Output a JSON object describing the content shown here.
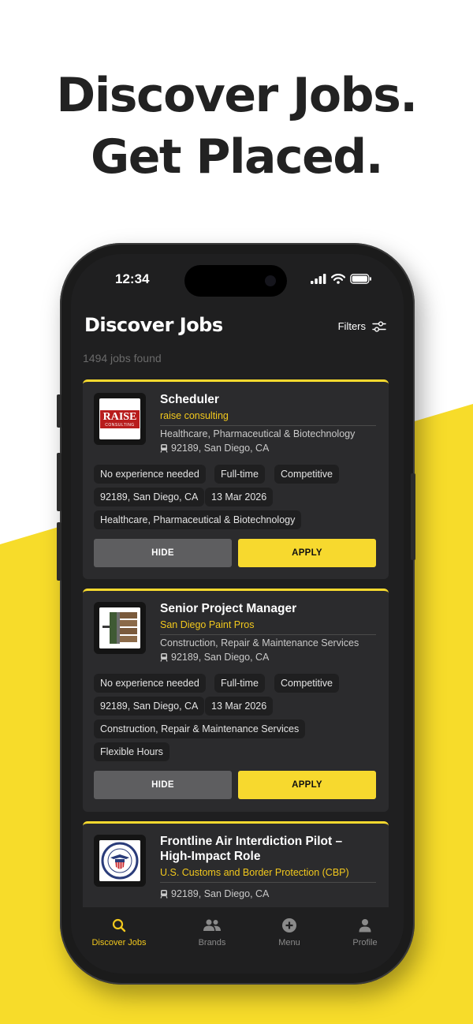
{
  "headline": {
    "line1": "Discover Jobs.",
    "line2": "Get Placed."
  },
  "colors": {
    "accent": "#f7d92e",
    "background_yellow": "#f7dc2a",
    "dark": "#1f1f20",
    "card": "#2b2b2d"
  },
  "status_bar": {
    "time": "12:34"
  },
  "header": {
    "title": "Discover Jobs",
    "filters_label": "Filters",
    "jobs_found": "1494 jobs found"
  },
  "jobs": [
    {
      "title": "Scheduler",
      "company": "raise consulting",
      "industry": "Healthcare, Pharmaceutical & Biotechnology",
      "location": "92189, San Diego, CA",
      "logo_text": "RAISE",
      "logo_subtext": "CONSULTING",
      "tags": [
        "No experience needed",
        "Full-time",
        "Competitive",
        "92189, San Diego, CA",
        "13 Mar 2026",
        "Healthcare, Pharmaceutical & Biotechnology"
      ],
      "hide_label": "HIDE",
      "apply_label": "APPLY"
    },
    {
      "title": "Senior Project Manager",
      "company": "San Diego Paint Pros",
      "industry": "Construction, Repair & Maintenance Services",
      "location": "92189, San Diego, CA",
      "tags": [
        "No experience needed",
        "Full-time",
        "Competitive",
        "92189, San Diego, CA",
        "13 Mar 2026",
        "Construction, Repair & Maintenance Services",
        "Flexible Hours"
      ],
      "hide_label": "HIDE",
      "apply_label": "APPLY"
    },
    {
      "title": "Frontline Air Interdiction Pilot – High-Impact Role",
      "company": "U.S. Customs and Border Protection (CBP)",
      "location": "92189, San Diego, CA"
    }
  ],
  "tabbar": {
    "items": [
      {
        "label": "Discover Jobs",
        "icon": "search-icon",
        "active": true
      },
      {
        "label": "Brands",
        "icon": "people-icon",
        "active": false
      },
      {
        "label": "Menu",
        "icon": "plus-circle-icon",
        "active": false
      },
      {
        "label": "Profile",
        "icon": "person-icon",
        "active": false
      }
    ]
  }
}
